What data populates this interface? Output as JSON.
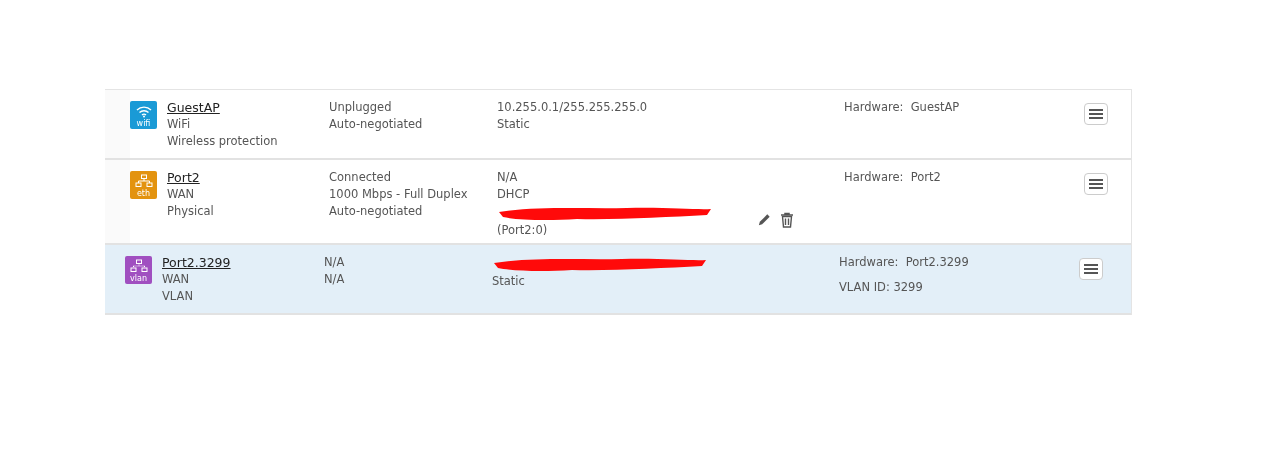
{
  "interfaces": [
    {
      "kind": "wifi",
      "badge": "wifi",
      "color": "#1a9ad6",
      "name": "GuestAP",
      "selected": false,
      "details": [
        "WiFi",
        "Wireless protection"
      ],
      "status": [
        "Unplugged",
        "Auto-negotiated"
      ],
      "address": [
        {
          "kind": "text",
          "text": "10.255.0.1/255.255.255.0"
        },
        {
          "kind": "text",
          "text": "Static"
        }
      ],
      "show_actions": false,
      "hardware": [
        "Hardware:  GuestAP"
      ]
    },
    {
      "kind": "eth",
      "badge": "eth",
      "color": "#e3930f",
      "name": "Port2",
      "selected": false,
      "details": [
        "WAN",
        "Physical"
      ],
      "status": [
        "Connected",
        "1000 Mbps - Full Duplex",
        "Auto-negotiated"
      ],
      "address": [
        {
          "kind": "text",
          "text": "N/A"
        },
        {
          "kind": "text",
          "text": "DHCP"
        },
        {
          "kind": "redacted"
        },
        {
          "kind": "text",
          "text": "(Port2:0)"
        }
      ],
      "show_actions": true,
      "hardware": [
        "Hardware:  Port2"
      ]
    },
    {
      "kind": "vlan",
      "badge": "vlan",
      "color": "#a04fc0",
      "name": "Port2.3299",
      "selected": true,
      "details": [
        "WAN",
        "VLAN"
      ],
      "status": [
        "N/A",
        "N/A"
      ],
      "address": [
        {
          "kind": "redacted"
        },
        {
          "kind": "text",
          "text": "Static"
        }
      ],
      "show_actions": false,
      "hardware": [
        "Hardware:  Port2.3299",
        "VLAN ID: 3299"
      ]
    }
  ]
}
